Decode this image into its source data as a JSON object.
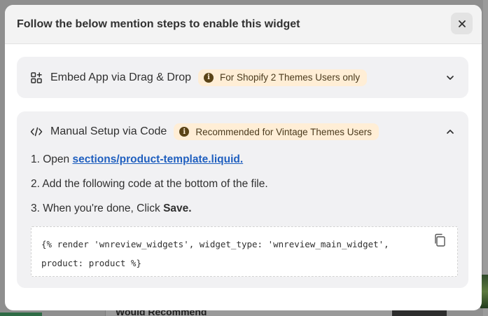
{
  "modal": {
    "title": "Follow the below mention steps to enable this widget",
    "close_icon": "close-icon"
  },
  "sections": {
    "embed": {
      "icon": "apps-icon",
      "title": "Embed App via Drag & Drop",
      "badge": "For Shopify 2 Themes Users only",
      "badge_icon": "info-icon",
      "expanded": false
    },
    "manual": {
      "icon": "code-icon",
      "title": "Manual Setup via Code",
      "badge": "Recommended for Vintage Themes Users",
      "badge_icon": "info-icon",
      "expanded": true,
      "steps": {
        "step1_prefix": "1. Open ",
        "step1_link": "sections/product-template.liquid.",
        "step2": "2. Add the following code at the bottom of the file.",
        "step3_prefix": "3. When you're done, Click ",
        "step3_bold": "Save."
      },
      "code": "{% render 'wnreview_widgets', widget_type: 'wnreview_main_widget', product: product %}",
      "copy_icon": "copy-icon"
    }
  },
  "background": {
    "card_text": "Would Recommend"
  },
  "colors": {
    "badge_bg": "#ffeed6",
    "link": "#1f5fbf",
    "section_bg": "#f1f1f3"
  }
}
